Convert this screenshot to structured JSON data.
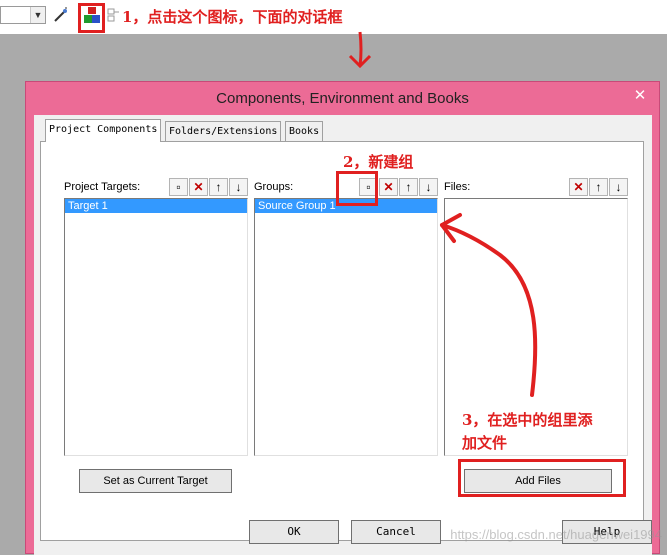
{
  "toolbar": {
    "annotation1": "1，点击这个图标，下面的对话框"
  },
  "dialog": {
    "title": "Components, Environment and Books",
    "close_glyph": "✕",
    "tabs": [
      {
        "label": "Project Components",
        "active": true
      },
      {
        "label": "Folders/Extensions",
        "active": false
      },
      {
        "label": "Books",
        "active": false
      }
    ],
    "targets": {
      "label": "Project Targets:",
      "items": [
        "Target 1"
      ]
    },
    "groups": {
      "label": "Groups:",
      "items": [
        "Source Group 1"
      ]
    },
    "files": {
      "label": "Files:",
      "items": []
    },
    "set_current_label": "Set as Current Target",
    "add_files_label": "Add Files",
    "ok_label": "OK",
    "cancel_label": "Cancel",
    "help_label": "Help"
  },
  "annotations": {
    "step2": "2，新建组",
    "step3_line1": "3，在选中的组里添",
    "step3_line2": "加文件"
  },
  "watermark": "https://blog.csdn.net/huagenwei1994",
  "colors": {
    "dialog_frame": "#ec6b96",
    "selection": "#3399ff",
    "annotation": "#e02020"
  }
}
